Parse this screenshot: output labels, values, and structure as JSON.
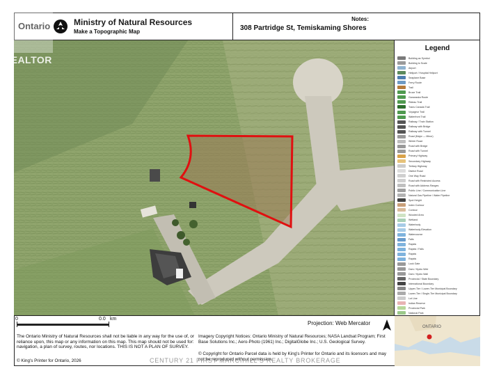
{
  "header": {
    "brand": "Ontario",
    "ministry": "Ministry of Natural Resources",
    "subtitle": "Make a Topographic Map",
    "notes_label": "Notes:",
    "address": "308 Partridge St, Temiskaming Shores"
  },
  "legend": {
    "title": "Legend",
    "items": [
      "Building as Symbol",
      "Building to Scale",
      "Airport",
      "Heliport / Hospital Heliport",
      "Seaplane Base",
      "Ferry Route",
      "Trail",
      "Bruce Trail",
      "Ganaraska Route",
      "Rideau Trail",
      "Trans Canada Trail",
      "Voyageur Trail",
      "Waterfront Trail",
      "Railway / Train Station",
      "Railway with Bridge",
      "Railway with Tunnel",
      "Road (Major — Minor)",
      "Winter Road",
      "Road with Bridge",
      "Road with Tunnel",
      "Primary Highway",
      "Secondary Highway",
      "Tertiary Highway",
      "District Road",
      "One Way Road",
      "Road with Restricted Access",
      "Road with Address Ranges",
      "Public Line / Communication Line",
      "Natural Gas Pipeline / Water Pipeline",
      "Spot Height",
      "Index Contour",
      "Contour",
      "Wooded Area",
      "Wetland",
      "Waterbody",
      "Waterbody Elevation",
      "Watercourse",
      "Falls",
      "Rapids",
      "Rapids / Falls",
      "Rapids",
      "Rapids",
      "Lock Gate",
      "Dam / Hydro Weir",
      "Dam / Hydro Wall",
      "Provincial / State Boundary",
      "International Boundary",
      "Upper-Tier / Lower-Tier Municipal Boundary",
      "Lower-Tier / Single-Tier Municipal Boundary",
      "Lot Line",
      "Indian Reserve",
      "Provincial Park",
      "National Park",
      "Conservation Reserve",
      "Military Lands"
    ],
    "colors": [
      "#7a7a7a",
      "#9a9a9a",
      "#8fb3cf",
      "#5c8a5c",
      "#4f7fb0",
      "#6e9ac4",
      "#b57c3c",
      "#4f9a4f",
      "#4f9a4f",
      "#4f9a4f",
      "#2d6f2d",
      "#4f9a4f",
      "#4f9a4f",
      "#555555",
      "#555555",
      "#555555",
      "#9a9a9a",
      "#bdbdbd",
      "#999999",
      "#999999",
      "#d9a34a",
      "#e6c27a",
      "#cccccc",
      "#dddddd",
      "#cfcfcf",
      "#cfcfcf",
      "#bfbfbf",
      "#a0a0a0",
      "#b3b3b3",
      "#444444",
      "#c9a07a",
      "#d9bc9c",
      "#cfe3c4",
      "#a9d0b8",
      "#a7cbe6",
      "#a7cbe6",
      "#7fb3dd",
      "#6a9ccc",
      "#7fb3dd",
      "#7fb3dd",
      "#7fb3dd",
      "#7fb3dd",
      "#999999",
      "#999999",
      "#999999",
      "#666666",
      "#444444",
      "#888888",
      "#aaaaaa",
      "#cccccc",
      "#e8b3b3",
      "#b7d79a",
      "#9cc98a",
      "#d3e6a8",
      "#e6b3d0"
    ]
  },
  "footer": {
    "scale_start": "0",
    "scale_end": "0.0",
    "scale_unit": "km",
    "disclaimer": "The Ontario Ministry of Natural Resources shall not be liable in any way for the use of, or reliance upon, this map or any information on this map. This map should not be used for: navigation, a plan of survey, routes, nor locations. THIS IS NOT A PLAN OF SURVEY.",
    "copyright": "© King's Printer for Ontario, 2026",
    "projection": "Projection: Web Mercator",
    "imagery": "Imagery Copyright Notices: Ontario Ministry of Natural Resources; NASA Landsat Program; First Base Solutions Inc.; Aero-Photo (1961) Inc.; DigitalGlobe Inc.; U.S. Geological Survey.",
    "parcel": "© Copyright for Ontario Parcel data is held by King's Printer for Ontario and its licensors and may not be reproduced without permission."
  },
  "inset": {
    "label": "ONTARIO",
    "land_color": "#efe6cf",
    "water_color": "#c9dbe8",
    "marker_color": "#d22020"
  },
  "map": {
    "parcel_outline_color": "#e01010",
    "field_color": "#8aa06a",
    "road_color": "#c8c4b8"
  },
  "overlay": {
    "realtor": "REALTOR",
    "watermark": "CENTURY 21 FIRST MARCIHILL'S REALTY BROKERAGE"
  }
}
